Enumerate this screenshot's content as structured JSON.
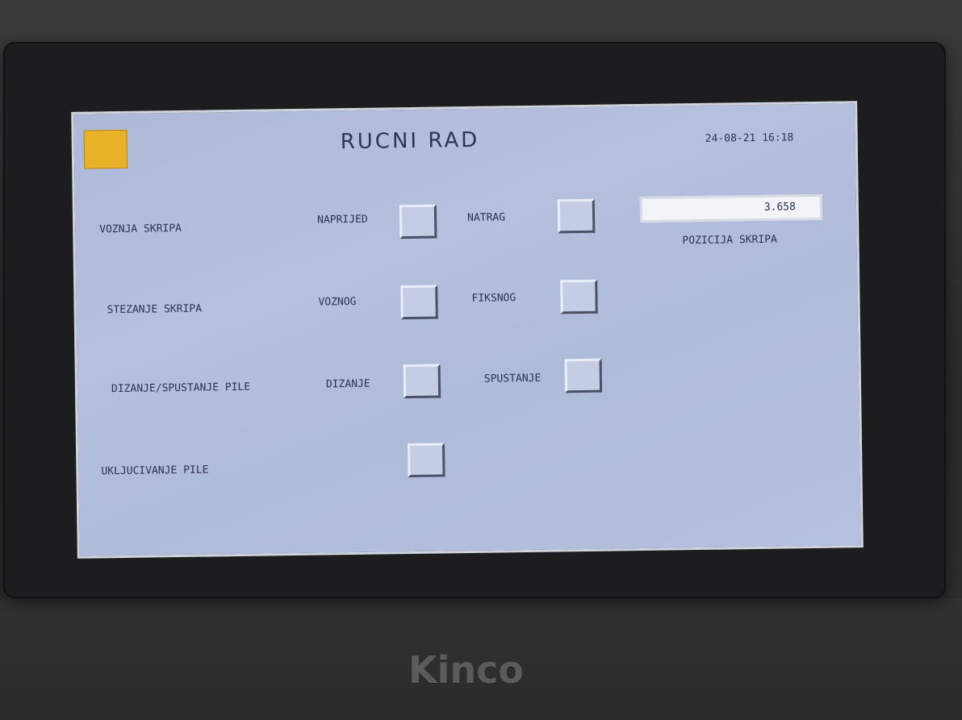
{
  "screen": {
    "title": "RUCNI RAD",
    "datetime": "24-08-21 16:18"
  },
  "rows": [
    {
      "label": "VOZNJA SKRIPA",
      "option_a": "NAPRIJED",
      "option_b": "NATRAG"
    },
    {
      "label": "STEZANJE SKRIPA",
      "option_a": "VOZNOG",
      "option_b": "FIKSNOG"
    },
    {
      "label": "DIZANJE/SPUSTANJE PILE",
      "option_a": "DIZANJE",
      "option_b": "SPUSTANJE"
    },
    {
      "label": "UKLJUCIVANJE PILE"
    }
  ],
  "position": {
    "value": "3.658",
    "label": "POZICIJA SKRIPA"
  },
  "device": {
    "brand": "Kinco"
  },
  "colors": {
    "screen_bg": "#b2bedb",
    "home_button": "#e8b128",
    "text": "#2a3350",
    "bezel": "#1d1d1f"
  }
}
